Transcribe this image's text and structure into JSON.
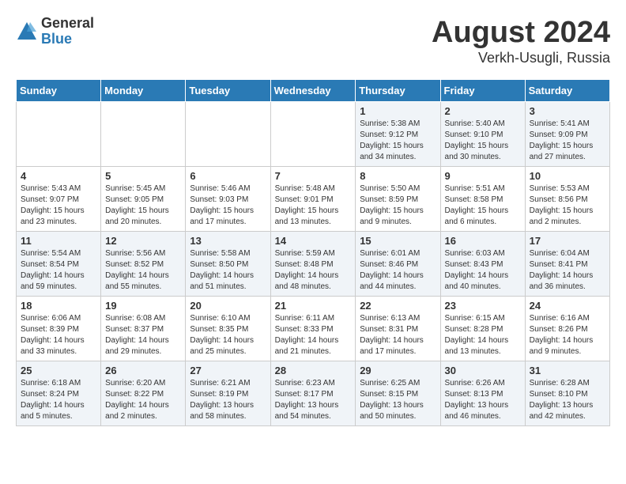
{
  "logo": {
    "general": "General",
    "blue": "Blue"
  },
  "title": {
    "month_year": "August 2024",
    "location": "Verkh-Usugli, Russia"
  },
  "weekdays": [
    "Sunday",
    "Monday",
    "Tuesday",
    "Wednesday",
    "Thursday",
    "Friday",
    "Saturday"
  ],
  "weeks": [
    [
      {
        "day": "",
        "info": ""
      },
      {
        "day": "",
        "info": ""
      },
      {
        "day": "",
        "info": ""
      },
      {
        "day": "",
        "info": ""
      },
      {
        "day": "1",
        "info": "Sunrise: 5:38 AM\nSunset: 9:12 PM\nDaylight: 15 hours\nand 34 minutes."
      },
      {
        "day": "2",
        "info": "Sunrise: 5:40 AM\nSunset: 9:10 PM\nDaylight: 15 hours\nand 30 minutes."
      },
      {
        "day": "3",
        "info": "Sunrise: 5:41 AM\nSunset: 9:09 PM\nDaylight: 15 hours\nand 27 minutes."
      }
    ],
    [
      {
        "day": "4",
        "info": "Sunrise: 5:43 AM\nSunset: 9:07 PM\nDaylight: 15 hours\nand 23 minutes."
      },
      {
        "day": "5",
        "info": "Sunrise: 5:45 AM\nSunset: 9:05 PM\nDaylight: 15 hours\nand 20 minutes."
      },
      {
        "day": "6",
        "info": "Sunrise: 5:46 AM\nSunset: 9:03 PM\nDaylight: 15 hours\nand 17 minutes."
      },
      {
        "day": "7",
        "info": "Sunrise: 5:48 AM\nSunset: 9:01 PM\nDaylight: 15 hours\nand 13 minutes."
      },
      {
        "day": "8",
        "info": "Sunrise: 5:50 AM\nSunset: 8:59 PM\nDaylight: 15 hours\nand 9 minutes."
      },
      {
        "day": "9",
        "info": "Sunrise: 5:51 AM\nSunset: 8:58 PM\nDaylight: 15 hours\nand 6 minutes."
      },
      {
        "day": "10",
        "info": "Sunrise: 5:53 AM\nSunset: 8:56 PM\nDaylight: 15 hours\nand 2 minutes."
      }
    ],
    [
      {
        "day": "11",
        "info": "Sunrise: 5:54 AM\nSunset: 8:54 PM\nDaylight: 14 hours\nand 59 minutes."
      },
      {
        "day": "12",
        "info": "Sunrise: 5:56 AM\nSunset: 8:52 PM\nDaylight: 14 hours\nand 55 minutes."
      },
      {
        "day": "13",
        "info": "Sunrise: 5:58 AM\nSunset: 8:50 PM\nDaylight: 14 hours\nand 51 minutes."
      },
      {
        "day": "14",
        "info": "Sunrise: 5:59 AM\nSunset: 8:48 PM\nDaylight: 14 hours\nand 48 minutes."
      },
      {
        "day": "15",
        "info": "Sunrise: 6:01 AM\nSunset: 8:46 PM\nDaylight: 14 hours\nand 44 minutes."
      },
      {
        "day": "16",
        "info": "Sunrise: 6:03 AM\nSunset: 8:43 PM\nDaylight: 14 hours\nand 40 minutes."
      },
      {
        "day": "17",
        "info": "Sunrise: 6:04 AM\nSunset: 8:41 PM\nDaylight: 14 hours\nand 36 minutes."
      }
    ],
    [
      {
        "day": "18",
        "info": "Sunrise: 6:06 AM\nSunset: 8:39 PM\nDaylight: 14 hours\nand 33 minutes."
      },
      {
        "day": "19",
        "info": "Sunrise: 6:08 AM\nSunset: 8:37 PM\nDaylight: 14 hours\nand 29 minutes."
      },
      {
        "day": "20",
        "info": "Sunrise: 6:10 AM\nSunset: 8:35 PM\nDaylight: 14 hours\nand 25 minutes."
      },
      {
        "day": "21",
        "info": "Sunrise: 6:11 AM\nSunset: 8:33 PM\nDaylight: 14 hours\nand 21 minutes."
      },
      {
        "day": "22",
        "info": "Sunrise: 6:13 AM\nSunset: 8:31 PM\nDaylight: 14 hours\nand 17 minutes."
      },
      {
        "day": "23",
        "info": "Sunrise: 6:15 AM\nSunset: 8:28 PM\nDaylight: 14 hours\nand 13 minutes."
      },
      {
        "day": "24",
        "info": "Sunrise: 6:16 AM\nSunset: 8:26 PM\nDaylight: 14 hours\nand 9 minutes."
      }
    ],
    [
      {
        "day": "25",
        "info": "Sunrise: 6:18 AM\nSunset: 8:24 PM\nDaylight: 14 hours\nand 5 minutes."
      },
      {
        "day": "26",
        "info": "Sunrise: 6:20 AM\nSunset: 8:22 PM\nDaylight: 14 hours\nand 2 minutes."
      },
      {
        "day": "27",
        "info": "Sunrise: 6:21 AM\nSunset: 8:19 PM\nDaylight: 13 hours\nand 58 minutes."
      },
      {
        "day": "28",
        "info": "Sunrise: 6:23 AM\nSunset: 8:17 PM\nDaylight: 13 hours\nand 54 minutes."
      },
      {
        "day": "29",
        "info": "Sunrise: 6:25 AM\nSunset: 8:15 PM\nDaylight: 13 hours\nand 50 minutes."
      },
      {
        "day": "30",
        "info": "Sunrise: 6:26 AM\nSunset: 8:13 PM\nDaylight: 13 hours\nand 46 minutes."
      },
      {
        "day": "31",
        "info": "Sunrise: 6:28 AM\nSunset: 8:10 PM\nDaylight: 13 hours\nand 42 minutes."
      }
    ]
  ]
}
